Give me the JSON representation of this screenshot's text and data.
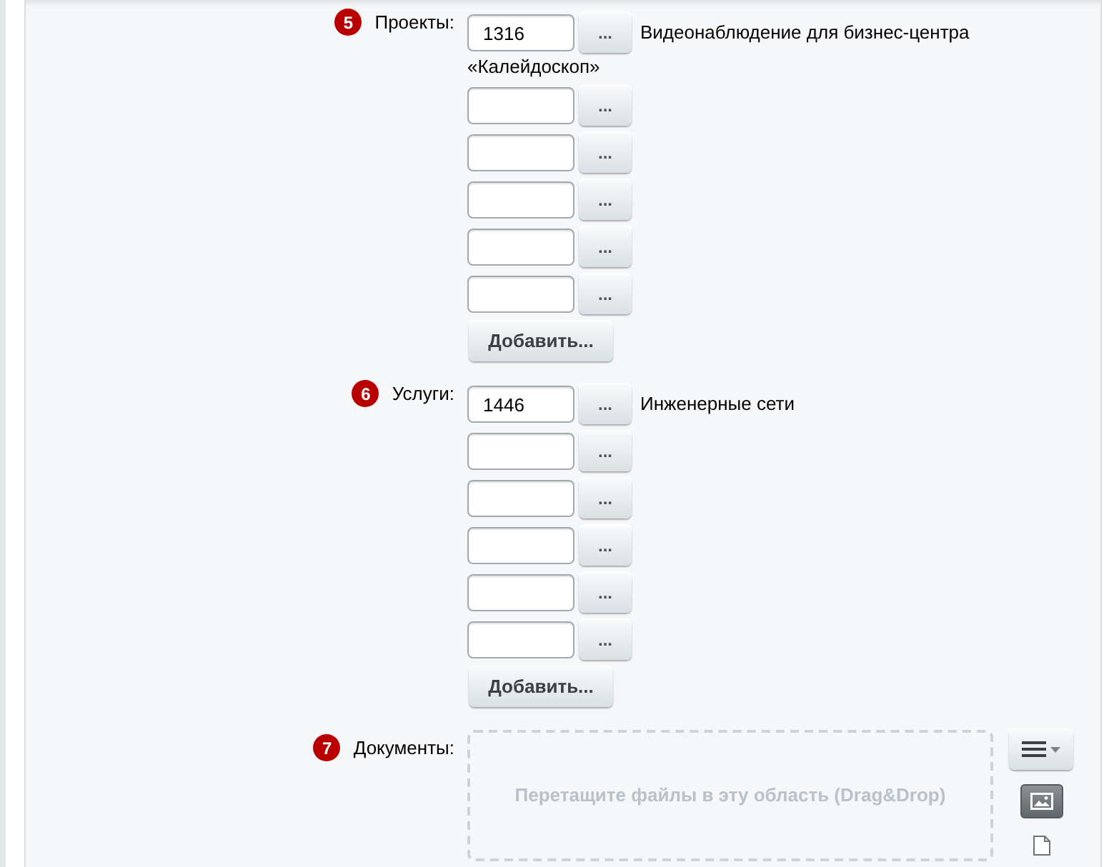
{
  "fields": [
    {
      "kind": "links",
      "number": "5",
      "label": "Проекты:",
      "rows": [
        {
          "value": "1316",
          "button": "...",
          "description_lines": [
            "Видеонаблюдение для бизнес-центра",
            "«Калейдоскоп»"
          ]
        },
        {
          "button": "..."
        },
        {
          "button": "..."
        },
        {
          "button": "..."
        },
        {
          "button": "..."
        },
        {
          "button": "..."
        }
      ],
      "add_button": "Добавить..."
    },
    {
      "kind": "links",
      "number": "6",
      "label": "Услуги:",
      "rows": [
        {
          "value": "1446",
          "button": "...",
          "description_lines": [
            "Инженерные сети"
          ]
        },
        {
          "button": "..."
        },
        {
          "button": "..."
        },
        {
          "button": "..."
        },
        {
          "button": "..."
        },
        {
          "button": "..."
        }
      ],
      "add_button": "Добавить..."
    },
    {
      "kind": "files",
      "number": "7",
      "label": "Документы:",
      "dropzone": "Перетащите файлы в эту область (Drag&Drop)"
    }
  ]
}
